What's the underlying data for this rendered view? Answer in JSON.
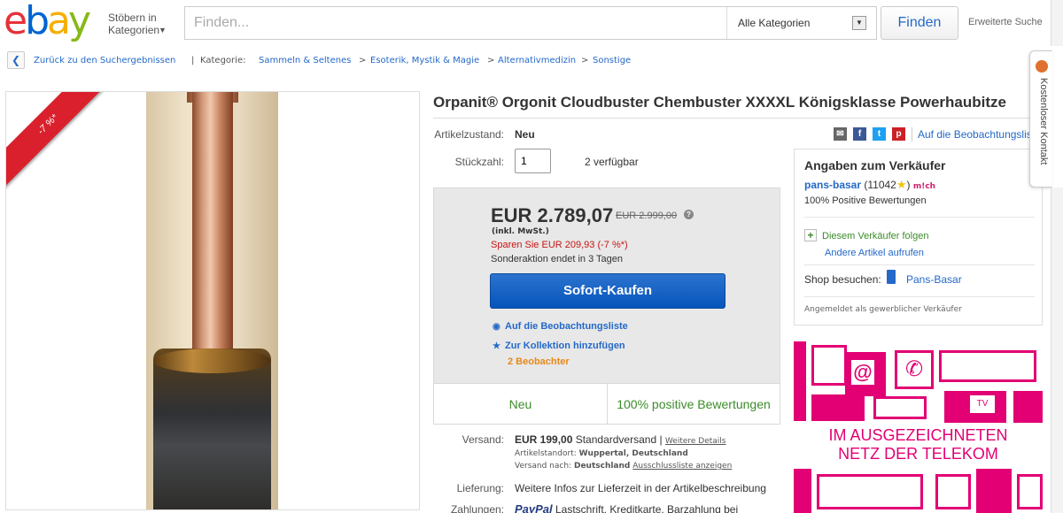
{
  "header": {
    "logo_letters": [
      "e",
      "b",
      "a",
      "y"
    ],
    "browse_line1": "Stöbern in",
    "browse_line2": "Kategorien",
    "search_placeholder": "Finden...",
    "category_select": "Alle Kategorien",
    "search_button": "Finden",
    "advanced_search": "Erweiterte Suche"
  },
  "breadcrumb": {
    "back_label": "Zurück zu den Suchergebnissen",
    "separator": "|",
    "category_label": "Kategorie:",
    "items": [
      "Sammeln & Seltenes",
      "Esoterik, Mystik & Magie",
      "Alternativmedizin",
      "Sonstige"
    ],
    "arrow": ">"
  },
  "image": {
    "ribbon_text": "-7 %*"
  },
  "item": {
    "title": "Orpanit® Orgonit Cloudbuster Chembuster XXXXL Königsklasse Powerhaubitze",
    "condition_label": "Artikelzustand:",
    "condition_value": "Neu",
    "quantity_label": "Stückzahl:",
    "quantity_value": "1",
    "available": "2 verfügbar",
    "watch_link": "Auf die Beobachtungsliste"
  },
  "buy_box": {
    "price": "EUR 2.789,07",
    "old_price": "EUR 2.999,00",
    "info_icon": "?",
    "vat": "(inkl. MwSt.)",
    "savings": "Sparen Sie EUR 209,93 (-7 %*)",
    "promo_end": "Sonderaktion endet in 3 Tagen",
    "buy_now": "Sofort-Kaufen",
    "watch_action": "Auf die Beobachtungsliste",
    "collection_action": "Zur Kollektion hinzufügen",
    "watchers": "2 Beobachter",
    "condition_badge": "Neu",
    "feedback_badge": "100% positive Bewertungen"
  },
  "shipping": {
    "shipping_label": "Versand:",
    "shipping_price": "EUR 199,00",
    "shipping_method": "Standardversand |",
    "shipping_details": "Weitere Details",
    "location_label": "Artikelstandort:",
    "location_value": "Wuppertal, Deutschland",
    "ship_to_label": "Versand nach:",
    "ship_to_value": "Deutschland",
    "exclusions": "Ausschlussliste anzeigen",
    "delivery_label": "Lieferung:",
    "delivery_value": "Weitere Infos zur Lieferzeit in der Artikelbeschreibung",
    "payment_label": "Zahlungen:",
    "paypal": "PayPal",
    "payment_value": "Lastschrift, Kreditkarte, Barzahlung bei"
  },
  "seller": {
    "title": "Angaben zum Verkäufer",
    "name": "pans-basar",
    "score_open": "(11042",
    "score_close": ")",
    "mich_logo": "m!ch",
    "positive": "100% Positive Bewertungen",
    "follow": "Diesem Verkäufer folgen",
    "other_items": "Andere Artikel aufrufen",
    "shop_label": "Shop besuchen:",
    "shop_name": "Pans-Basar",
    "commercial": "Angemeldet als gewerblicher Verkäufer"
  },
  "contact_tab": "Kostenloser Kontakt",
  "ad": {
    "line1": "IM AUSGEZEICHNETEN",
    "line2": "NETZ DER TELEKOM",
    "tv_label": "TV"
  },
  "colors": {
    "ebay_red": "#e53238",
    "ebay_blue": "#0064d2",
    "ebay_yellow": "#f5af02",
    "ebay_green": "#86b817",
    "link_blue": "#2469c9",
    "buy_button": "#0654ba",
    "savings_red": "#c81414",
    "positive_green": "#3c8c2a",
    "watchers_orange": "#e8891a",
    "telekom_magenta": "#e20074"
  }
}
